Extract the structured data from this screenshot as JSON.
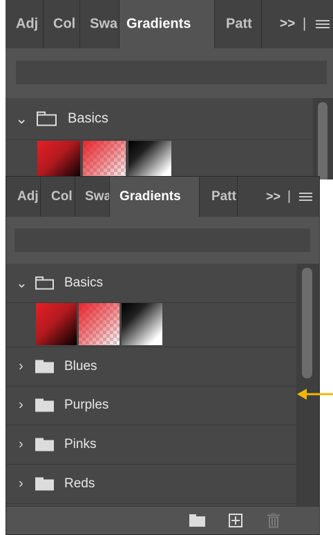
{
  "back_panel": {
    "tabs": [
      "Adj",
      "Col",
      "Swa",
      "Gradients",
      "Patt"
    ],
    "overflow_label": ">>",
    "sep_label": "|",
    "group": {
      "label": "Basics",
      "expanded": true
    }
  },
  "front_panel": {
    "tabs": [
      "Adj",
      "Col",
      "Swa",
      "Gradients",
      "Patt"
    ],
    "overflow_label": ">>",
    "sep_label": "|",
    "search": {
      "value": "",
      "placeholder": ""
    },
    "groups": [
      {
        "label": "Basics",
        "expanded": true
      },
      {
        "label": "Blues",
        "expanded": false
      },
      {
        "label": "Purples",
        "expanded": false
      },
      {
        "label": "Pinks",
        "expanded": false
      },
      {
        "label": "Reds",
        "expanded": false
      }
    ],
    "basics_swatches": [
      "red-to-black",
      "red-to-transparent",
      "black-to-white"
    ],
    "bottom_icons": [
      "new-folder-icon",
      "add-icon",
      "trash-icon"
    ]
  },
  "annotation": {
    "arrow_color": "#f2b705"
  }
}
